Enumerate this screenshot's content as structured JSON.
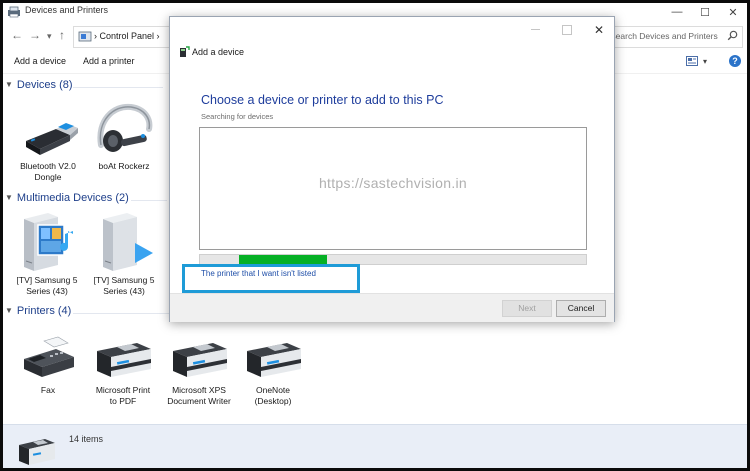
{
  "window": {
    "title": "Devices and Printers",
    "minimize": "—",
    "maximize": "☐",
    "close": "✕"
  },
  "nav": {
    "back": "←",
    "forward": "→",
    "recent": "▾",
    "up": "↑",
    "breadcrumb": "› Control Panel  ›",
    "search_placeholder": "Search Devices and Printers"
  },
  "commands": {
    "add_device": "Add a device",
    "add_printer": "Add a printer",
    "view_menu": "▾",
    "help": "?"
  },
  "groups": {
    "devices": "Devices (8)",
    "multimedia": "Multimedia Devices (2)",
    "printers": "Printers (4)"
  },
  "devices": [
    {
      "label": "Bluetooth V2.0\nDongle",
      "icon": "usb-dongle-icon"
    },
    {
      "label": "boAt Rockerz",
      "icon": "headset-icon"
    }
  ],
  "multimedia": [
    {
      "label": "[TV] Samsung 5\nSeries (43)",
      "icon": "media-server-icon"
    },
    {
      "label": "[TV] Samsung 5\nSeries (43)",
      "icon": "media-device-icon"
    }
  ],
  "printers": [
    {
      "label": "Fax",
      "icon": "fax-icon"
    },
    {
      "label": "Microsoft Print\nto PDF",
      "icon": "printer-icon"
    },
    {
      "label": "Microsoft XPS\nDocument Writer",
      "icon": "printer-icon"
    },
    {
      "label": "OneNote\n(Desktop)",
      "icon": "printer-icon"
    }
  ],
  "status": {
    "item_count": "14 items"
  },
  "dialog": {
    "title": "Add a device",
    "heading": "Choose a device or printer to add to this PC",
    "subtext": "Searching for devices",
    "watermark": "https://sastechvision.in",
    "progress_fraction": 0.23,
    "link": "The printer that I want isn't listed",
    "next_label": "Next",
    "cancel_label": "Cancel",
    "close": "✕"
  },
  "colors": {
    "group_heading": "#1e3f8a",
    "dialog_heading": "#1e3d9c",
    "progress": "#06b025",
    "highlight": "#1e9bd7"
  }
}
